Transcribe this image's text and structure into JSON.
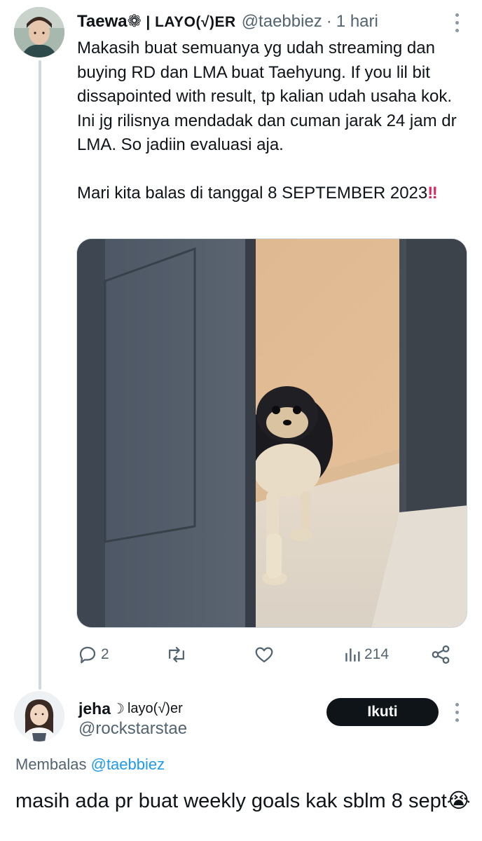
{
  "tweet": {
    "author_name": "Taewa",
    "author_badge_text": "| LAYO(√)ER",
    "handle": "@taebbiez",
    "separator": "·",
    "time": "1 hari",
    "text_paragraph1": "Makasih buat semuanya yg udah streaming dan buying RD dan LMA buat Taehyung. If you lil bit dissapointed with result, tp kalian udah usaha kok. Ini jg rilisnya mendadak dan cuman jarak 24 jam dr LMA. So jadiin evaluasi aja.",
    "text_paragraph2": "Mari kita balas di tanggal 8 SEPTEMBER 2023",
    "text_emoji": "‼",
    "media_subject": "pomeranian dog peeking behind door"
  },
  "actions": {
    "reply_count": "2",
    "retweet_count": "",
    "like_count": "",
    "view_count": "214"
  },
  "reply": {
    "author_name": "jeha",
    "author_badge_text": "layo(√)er",
    "handle": "@rockstarstae",
    "follow_label": "Ikuti",
    "replying_prefix": "Membalas",
    "replying_to": "@taebbiez",
    "text": "masih ada pr buat weekly goals kak sblm 8 sept",
    "text_emoji": "😭"
  },
  "icons": {
    "reply": "speech-bubble-icon",
    "retweet": "retweet-arrows-icon",
    "like": "heart-icon",
    "views": "bar-chart-icon",
    "share": "share-nodes-icon",
    "more": "vertical-dots-icon"
  },
  "colors": {
    "text": "#0f1419",
    "muted": "#536471",
    "link": "#1d9bf0",
    "thread_line": "#cfd9de",
    "button_bg": "#0f1419",
    "alert": "#e0245e"
  }
}
